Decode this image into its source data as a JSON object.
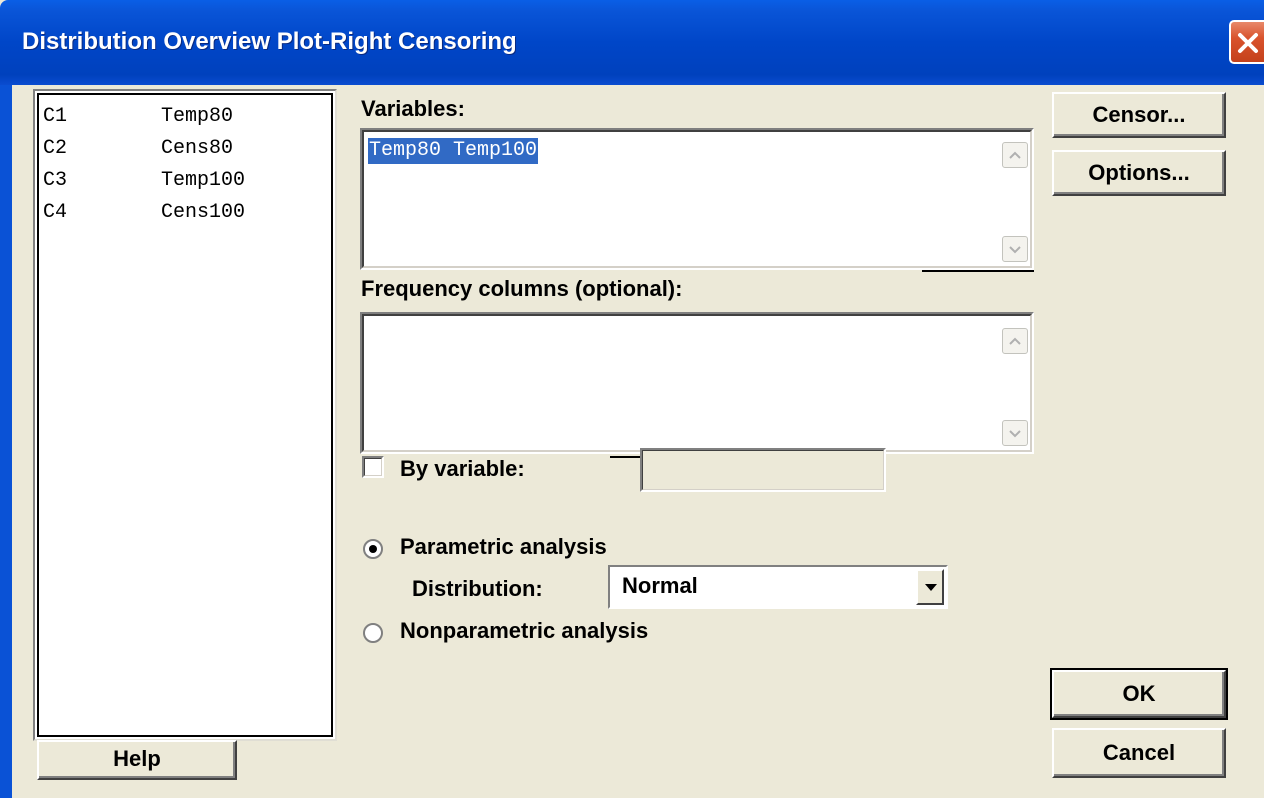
{
  "window": {
    "title": "Distribution Overview Plot-Right Censoring"
  },
  "columns_list": {
    "items": [
      {
        "id": "C1",
        "name": "Temp80"
      },
      {
        "id": "C2",
        "name": "Cens80"
      },
      {
        "id": "C3",
        "name": "Temp100"
      },
      {
        "id": "C4",
        "name": "Cens100"
      }
    ]
  },
  "variables": {
    "label": "Variables:",
    "value": "Temp80 Temp100"
  },
  "frequency": {
    "label": "Frequency columns (optional):",
    "value": ""
  },
  "by_variable": {
    "label": "By variable:",
    "checked": false,
    "value": ""
  },
  "analysis": {
    "parametric_label": "Parametric analysis",
    "parametric_selected": true,
    "distribution_label": "Distribution:",
    "distribution_value": "Normal",
    "nonparametric_label": "Nonparametric analysis",
    "nonparametric_selected": false
  },
  "buttons": {
    "censor": "Censor...",
    "options": "Options...",
    "help": "Help",
    "ok": "OK",
    "cancel": "Cancel"
  },
  "icons": {
    "close": "close-icon",
    "scroll_up": "scroll-up-icon",
    "scroll_down": "scroll-down-icon",
    "dropdown": "chevron-down-icon"
  },
  "colors": {
    "title_bar": "#0046c8",
    "dialog_bg": "#ece9d8",
    "selection": "#316ac5",
    "close_button": "#d9532d"
  }
}
